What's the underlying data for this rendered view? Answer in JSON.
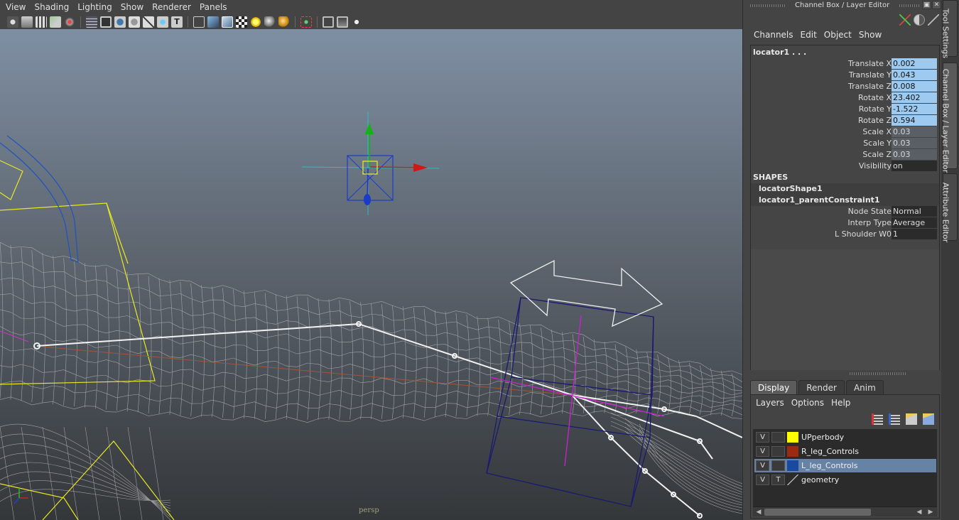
{
  "viewport": {
    "menus": [
      "View",
      "Shading",
      "Lighting",
      "Show",
      "Renderer",
      "Panels"
    ],
    "camera_label": "persp"
  },
  "panel": {
    "title": "Channel Box / Layer Editor",
    "menus": [
      "Channels",
      "Edit",
      "Object",
      "Show"
    ],
    "object_name": "locator1 . . .",
    "attributes": [
      {
        "label": "Translate X",
        "value": "0.002",
        "state": "selected"
      },
      {
        "label": "Translate Y",
        "value": "0.043",
        "state": "selected"
      },
      {
        "label": "Translate Z",
        "value": "0.008",
        "state": "selected"
      },
      {
        "label": "Rotate X",
        "value": "23.402",
        "state": "selected"
      },
      {
        "label": "Rotate Y",
        "value": "-1.522",
        "state": "selected"
      },
      {
        "label": "Rotate Z",
        "value": "0.594",
        "state": "selected"
      },
      {
        "label": "Scale X",
        "value": "0.03",
        "state": "locked"
      },
      {
        "label": "Scale Y",
        "value": "0.03",
        "state": "locked"
      },
      {
        "label": "Scale Z",
        "value": "0.03",
        "state": "locked"
      },
      {
        "label": "Visibility",
        "value": "on",
        "state": "plain"
      }
    ],
    "shapes_header": "SHAPES",
    "shapes": [
      "locatorShape1",
      "locator1_parentConstraint1"
    ],
    "constraint_attributes": [
      {
        "label": "Node State",
        "value": "Normal"
      },
      {
        "label": "Interp Type",
        "value": "Average"
      },
      {
        "label": "L Shoulder W0",
        "value": "1"
      }
    ]
  },
  "layer_editor": {
    "tabs": [
      "Display",
      "Render",
      "Anim"
    ],
    "active_tab": "Display",
    "menus": [
      "Layers",
      "Options",
      "Help"
    ],
    "layers": [
      {
        "v": "V",
        "t": "",
        "color": "#ffff00",
        "name": "UPperbody",
        "selected": false
      },
      {
        "v": "V",
        "t": "",
        "color": "#9a2a12",
        "name": "R_leg_Controls",
        "selected": false
      },
      {
        "v": "V",
        "t": "",
        "color": "#1a4aa0",
        "name": "L_leg_Controls",
        "selected": true
      },
      {
        "v": "V",
        "t": "T",
        "color": "",
        "name": "geometry",
        "selected": false
      }
    ]
  },
  "side_tabs": [
    "Tool Settings",
    "Channel Box / Layer Editor",
    "Attribute Editor"
  ]
}
